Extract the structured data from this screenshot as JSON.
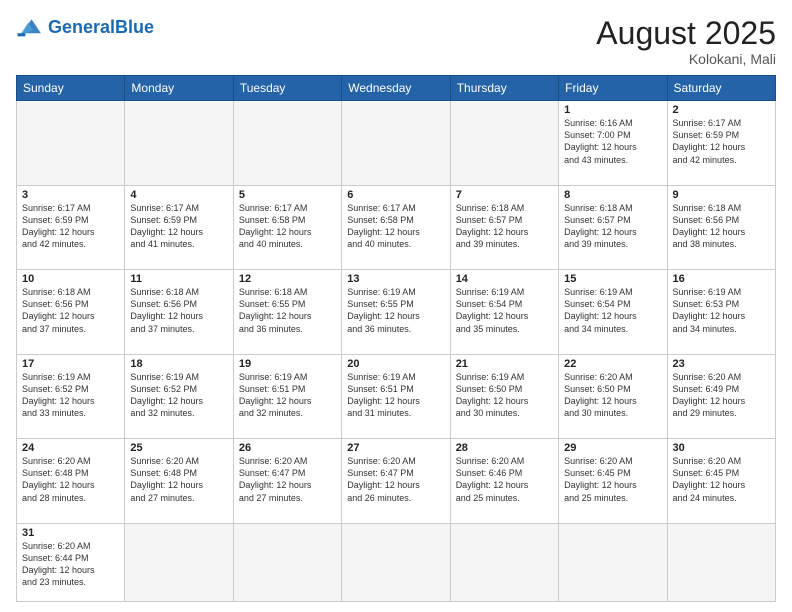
{
  "logo": {
    "general": "General",
    "blue": "Blue"
  },
  "title": "August 2025",
  "location": "Kolokani, Mali",
  "days_header": [
    "Sunday",
    "Monday",
    "Tuesday",
    "Wednesday",
    "Thursday",
    "Friday",
    "Saturday"
  ],
  "weeks": [
    [
      {
        "day": "",
        "info": ""
      },
      {
        "day": "",
        "info": ""
      },
      {
        "day": "",
        "info": ""
      },
      {
        "day": "",
        "info": ""
      },
      {
        "day": "",
        "info": ""
      },
      {
        "day": "1",
        "info": "Sunrise: 6:16 AM\nSunset: 7:00 PM\nDaylight: 12 hours\nand 43 minutes."
      },
      {
        "day": "2",
        "info": "Sunrise: 6:17 AM\nSunset: 6:59 PM\nDaylight: 12 hours\nand 42 minutes."
      }
    ],
    [
      {
        "day": "3",
        "info": "Sunrise: 6:17 AM\nSunset: 6:59 PM\nDaylight: 12 hours\nand 42 minutes."
      },
      {
        "day": "4",
        "info": "Sunrise: 6:17 AM\nSunset: 6:59 PM\nDaylight: 12 hours\nand 41 minutes."
      },
      {
        "day": "5",
        "info": "Sunrise: 6:17 AM\nSunset: 6:58 PM\nDaylight: 12 hours\nand 40 minutes."
      },
      {
        "day": "6",
        "info": "Sunrise: 6:17 AM\nSunset: 6:58 PM\nDaylight: 12 hours\nand 40 minutes."
      },
      {
        "day": "7",
        "info": "Sunrise: 6:18 AM\nSunset: 6:57 PM\nDaylight: 12 hours\nand 39 minutes."
      },
      {
        "day": "8",
        "info": "Sunrise: 6:18 AM\nSunset: 6:57 PM\nDaylight: 12 hours\nand 39 minutes."
      },
      {
        "day": "9",
        "info": "Sunrise: 6:18 AM\nSunset: 6:56 PM\nDaylight: 12 hours\nand 38 minutes."
      }
    ],
    [
      {
        "day": "10",
        "info": "Sunrise: 6:18 AM\nSunset: 6:56 PM\nDaylight: 12 hours\nand 37 minutes."
      },
      {
        "day": "11",
        "info": "Sunrise: 6:18 AM\nSunset: 6:56 PM\nDaylight: 12 hours\nand 37 minutes."
      },
      {
        "day": "12",
        "info": "Sunrise: 6:18 AM\nSunset: 6:55 PM\nDaylight: 12 hours\nand 36 minutes."
      },
      {
        "day": "13",
        "info": "Sunrise: 6:19 AM\nSunset: 6:55 PM\nDaylight: 12 hours\nand 36 minutes."
      },
      {
        "day": "14",
        "info": "Sunrise: 6:19 AM\nSunset: 6:54 PM\nDaylight: 12 hours\nand 35 minutes."
      },
      {
        "day": "15",
        "info": "Sunrise: 6:19 AM\nSunset: 6:54 PM\nDaylight: 12 hours\nand 34 minutes."
      },
      {
        "day": "16",
        "info": "Sunrise: 6:19 AM\nSunset: 6:53 PM\nDaylight: 12 hours\nand 34 minutes."
      }
    ],
    [
      {
        "day": "17",
        "info": "Sunrise: 6:19 AM\nSunset: 6:52 PM\nDaylight: 12 hours\nand 33 minutes."
      },
      {
        "day": "18",
        "info": "Sunrise: 6:19 AM\nSunset: 6:52 PM\nDaylight: 12 hours\nand 32 minutes."
      },
      {
        "day": "19",
        "info": "Sunrise: 6:19 AM\nSunset: 6:51 PM\nDaylight: 12 hours\nand 32 minutes."
      },
      {
        "day": "20",
        "info": "Sunrise: 6:19 AM\nSunset: 6:51 PM\nDaylight: 12 hours\nand 31 minutes."
      },
      {
        "day": "21",
        "info": "Sunrise: 6:19 AM\nSunset: 6:50 PM\nDaylight: 12 hours\nand 30 minutes."
      },
      {
        "day": "22",
        "info": "Sunrise: 6:20 AM\nSunset: 6:50 PM\nDaylight: 12 hours\nand 30 minutes."
      },
      {
        "day": "23",
        "info": "Sunrise: 6:20 AM\nSunset: 6:49 PM\nDaylight: 12 hours\nand 29 minutes."
      }
    ],
    [
      {
        "day": "24",
        "info": "Sunrise: 6:20 AM\nSunset: 6:48 PM\nDaylight: 12 hours\nand 28 minutes."
      },
      {
        "day": "25",
        "info": "Sunrise: 6:20 AM\nSunset: 6:48 PM\nDaylight: 12 hours\nand 27 minutes."
      },
      {
        "day": "26",
        "info": "Sunrise: 6:20 AM\nSunset: 6:47 PM\nDaylight: 12 hours\nand 27 minutes."
      },
      {
        "day": "27",
        "info": "Sunrise: 6:20 AM\nSunset: 6:47 PM\nDaylight: 12 hours\nand 26 minutes."
      },
      {
        "day": "28",
        "info": "Sunrise: 6:20 AM\nSunset: 6:46 PM\nDaylight: 12 hours\nand 25 minutes."
      },
      {
        "day": "29",
        "info": "Sunrise: 6:20 AM\nSunset: 6:45 PM\nDaylight: 12 hours\nand 25 minutes."
      },
      {
        "day": "30",
        "info": "Sunrise: 6:20 AM\nSunset: 6:45 PM\nDaylight: 12 hours\nand 24 minutes."
      }
    ],
    [
      {
        "day": "31",
        "info": "Sunrise: 6:20 AM\nSunset: 6:44 PM\nDaylight: 12 hours\nand 23 minutes."
      },
      {
        "day": "",
        "info": ""
      },
      {
        "day": "",
        "info": ""
      },
      {
        "day": "",
        "info": ""
      },
      {
        "day": "",
        "info": ""
      },
      {
        "day": "",
        "info": ""
      },
      {
        "day": "",
        "info": ""
      }
    ]
  ]
}
